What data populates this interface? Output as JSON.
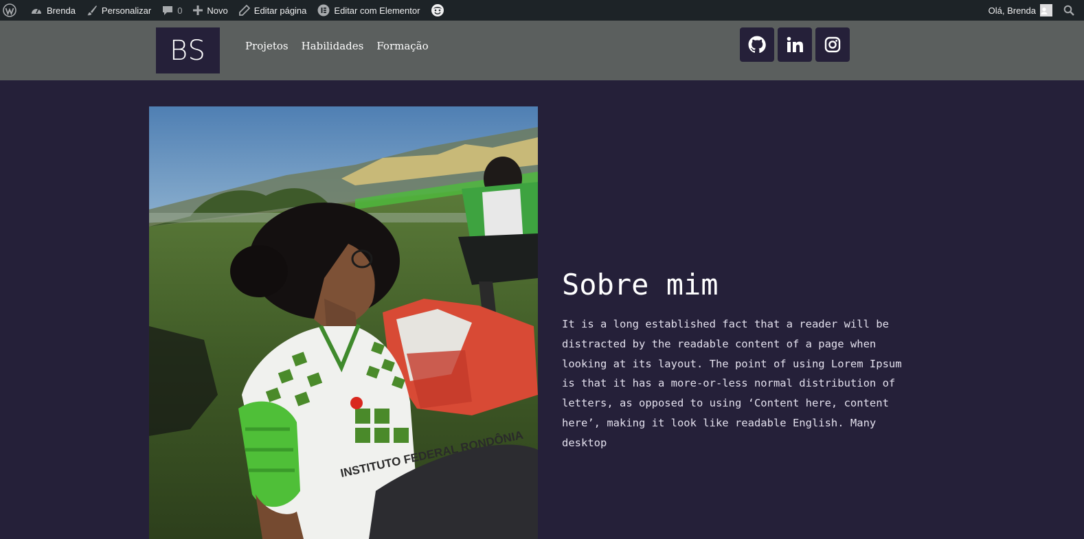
{
  "admin_bar": {
    "site_name": "Brenda",
    "customize": "Personalizar",
    "comments_count": "0",
    "new": "Novo",
    "edit_page": "Editar página",
    "edit_elementor": "Editar com Elementor",
    "greeting": "Olá, Brenda"
  },
  "header": {
    "logo_text": "BS",
    "nav": [
      "Projetos",
      "Habilidades",
      "Formação"
    ],
    "social": [
      {
        "icon": "github-icon"
      },
      {
        "icon": "linkedin-icon"
      },
      {
        "icon": "instagram-icon"
      }
    ]
  },
  "about": {
    "title": "Sobre mim",
    "text": "It is a long established fact that a reader will be distracted by the readable content of a page when looking at its layout. The point of using Lorem Ipsum is that it has a more-or-less normal distribution of letters, as opposed to using ‘Content here, content here’, making it look like readable English. Many desktop",
    "photo_logo_text": "INSTITUTO FEDERAL RONDÔNIA"
  },
  "colors": {
    "admin_bar_bg": "#1d2327",
    "header_bg": "#5b5f5e",
    "page_bg": "#252039",
    "accent": "#252039"
  }
}
